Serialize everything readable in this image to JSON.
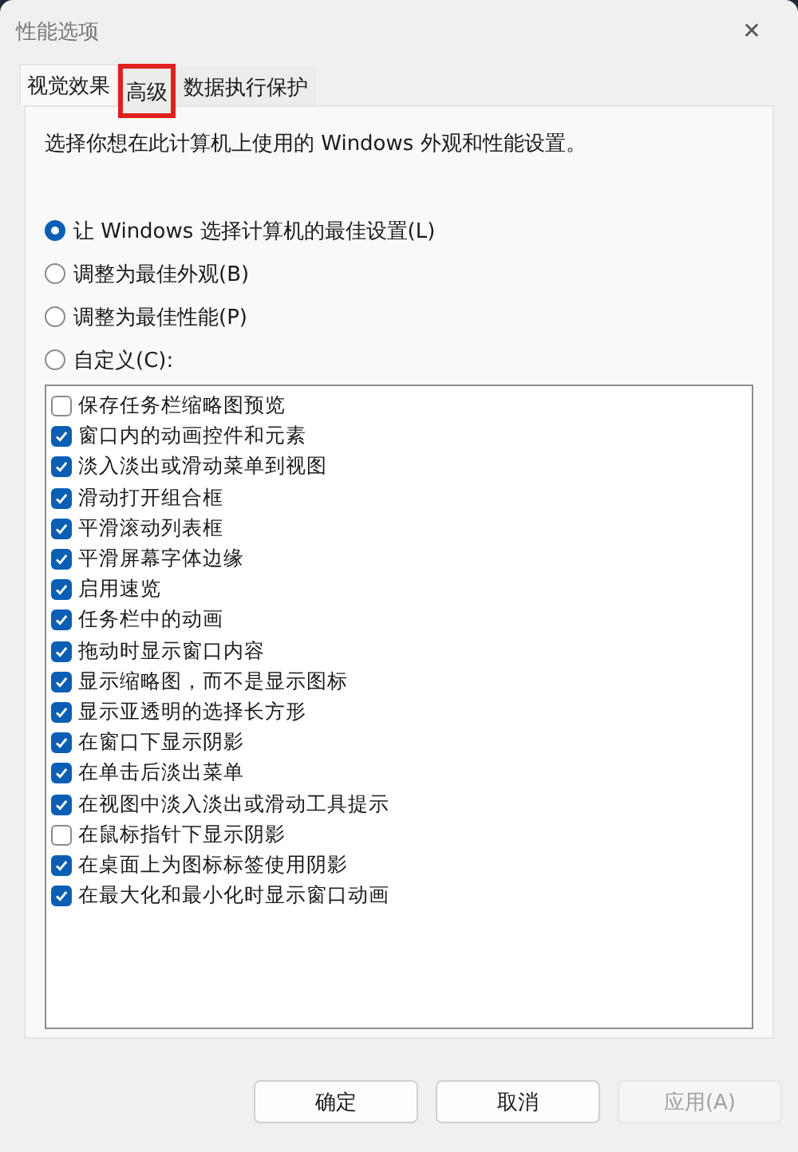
{
  "window": {
    "title": "性能选项",
    "close": "✕"
  },
  "tabs": [
    {
      "label": "视觉效果",
      "selected": true,
      "highlighted": false
    },
    {
      "label": "高级",
      "selected": false,
      "highlighted": true
    },
    {
      "label": "数据执行保护",
      "selected": false,
      "highlighted": false
    }
  ],
  "description": "选择你想在此计算机上使用的 Windows 外观和性能设置。",
  "options": [
    {
      "label": "让 Windows 选择计算机的最佳设置(L)",
      "selected": true
    },
    {
      "label": "调整为最佳外观(B)",
      "selected": false
    },
    {
      "label": "调整为最佳性能(P)",
      "selected": false
    },
    {
      "label": "自定义(C):",
      "selected": false
    }
  ],
  "effects": [
    {
      "label": "保存任务栏缩略图预览",
      "checked": false
    },
    {
      "label": "窗口内的动画控件和元素",
      "checked": true
    },
    {
      "label": "淡入淡出或滑动菜单到视图",
      "checked": true
    },
    {
      "label": "滑动打开组合框",
      "checked": true
    },
    {
      "label": "平滑滚动列表框",
      "checked": true
    },
    {
      "label": "平滑屏幕字体边缘",
      "checked": true
    },
    {
      "label": "启用速览",
      "checked": true
    },
    {
      "label": "任务栏中的动画",
      "checked": true
    },
    {
      "label": "拖动时显示窗口内容",
      "checked": true
    },
    {
      "label": "显示缩略图，而不是显示图标",
      "checked": true
    },
    {
      "label": "显示亚透明的选择长方形",
      "checked": true
    },
    {
      "label": "在窗口下显示阴影",
      "checked": true
    },
    {
      "label": "在单击后淡出菜单",
      "checked": true
    },
    {
      "label": "在视图中淡入淡出或滑动工具提示",
      "checked": true
    },
    {
      "label": "在鼠标指针下显示阴影",
      "checked": false
    },
    {
      "label": "在桌面上为图标标签使用阴影",
      "checked": true
    },
    {
      "label": "在最大化和最小化时显示窗口动画",
      "checked": true
    }
  ],
  "buttons": [
    {
      "label": "确定",
      "disabled": false
    },
    {
      "label": "取消",
      "disabled": false
    },
    {
      "label": "应用(A)",
      "disabled": true
    }
  ]
}
